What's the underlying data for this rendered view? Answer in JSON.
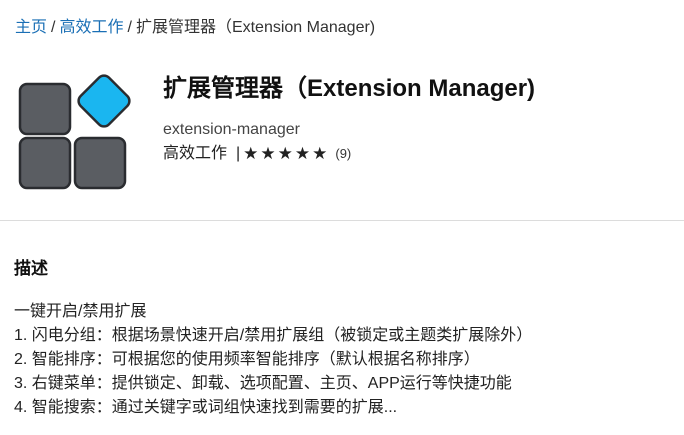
{
  "breadcrumb": {
    "home": "主页",
    "category": "高效工作",
    "current": "扩展管理器（Extension Manager)",
    "separator": "/"
  },
  "app": {
    "icon": "extension-grid-icon",
    "title": "扩展管理器（Extension Manager)",
    "id": "extension-manager",
    "category": "高效工作",
    "rating_separator": "|",
    "stars": "★★★★★",
    "rating_value": 5,
    "rating_count": "(9)"
  },
  "description": {
    "heading": "描述",
    "lines": [
      "一键开启/禁用扩展",
      "1. 闪电分组：根据场景快速开启/禁用扩展组（被锁定或主题类扩展除外）",
      "2. 智能排序：可根据您的使用频率智能排序（默认根据名称排序）",
      "3. 右键菜单：提供锁定、卸载、选项配置、主页、APP运行等快捷功能",
      "4. 智能搜索：通过关键字或词组快速找到需要的扩展..."
    ]
  },
  "colors": {
    "link": "#1a6fb5",
    "tile_gray": "#5a5d62",
    "tile_accent": "#1ab6f0",
    "tile_outline": "#2a2c30"
  }
}
